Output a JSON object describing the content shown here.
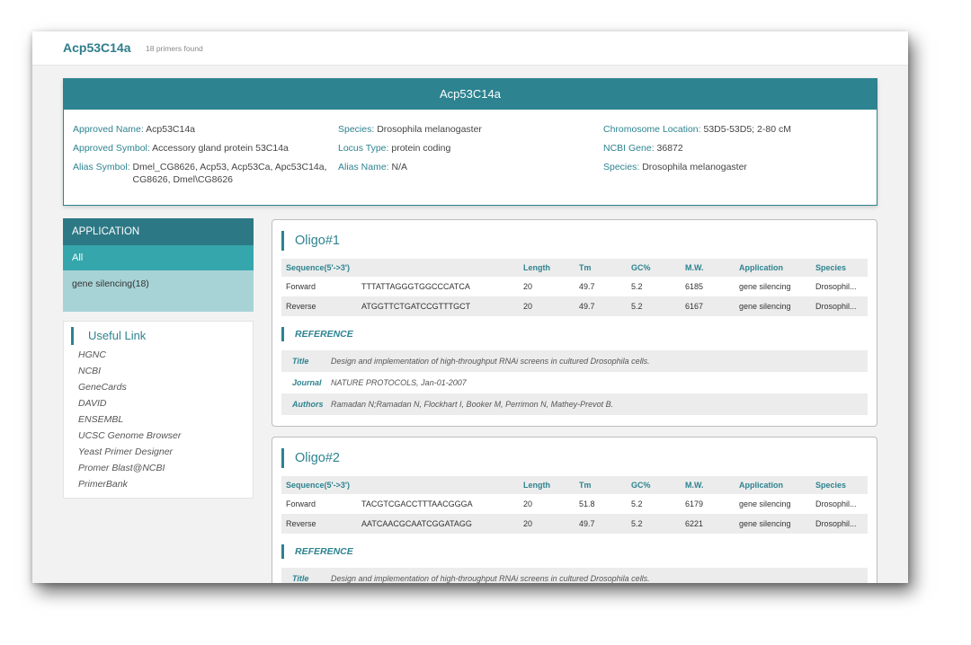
{
  "header": {
    "gene": "Acp53C14a",
    "count": "18 primers found"
  },
  "info": {
    "title": "Acp53C14a",
    "col1": [
      {
        "key": "Approved Name:",
        "value": "Acp53C14a"
      },
      {
        "key": "Approved Symbol:",
        "value": "Accessory gland protein 53C14a"
      },
      {
        "key": "Alias Symbol:",
        "value": "Dmel_CG8626, Acp53, Acp53Ca, Apc53C14a, CG8626, Dmel\\CG8626"
      }
    ],
    "col2": [
      {
        "key": "Species:",
        "value": "Drosophila melanogaster"
      },
      {
        "key": "Locus Type:",
        "value": "protein coding"
      },
      {
        "key": "Alias Name:",
        "value": "N/A"
      }
    ],
    "col3": [
      {
        "key": "Chromosome Location:",
        "value": "53D5-53D5; 2-80 cM"
      },
      {
        "key": "NCBI Gene:",
        "value": "36872"
      },
      {
        "key": "Species:",
        "value": "Drosophila melanogaster"
      }
    ]
  },
  "application": {
    "title": "APPLICATION",
    "all": "All",
    "option": "gene silencing(18)"
  },
  "links": {
    "title": "Useful Link",
    "items": [
      "HGNC",
      "NCBI",
      "GeneCards",
      "DAVID",
      "ENSEMBL",
      "UCSC Genome Browser",
      "Yeast Primer Designer",
      "Promer Blast@NCBI",
      "PrimerBank"
    ]
  },
  "table_headers": [
    "Sequence(5'->3')",
    "",
    "Length",
    "Tm",
    "GC%",
    "M.W.",
    "Application",
    "Species"
  ],
  "reference_label": "REFERENCE",
  "oligos": [
    {
      "title": "Oligo#1",
      "rows": [
        [
          "Forward",
          "TTTATTAGGGTGGCCCATCA",
          "20",
          "49.7",
          "5.2",
          "6185",
          "gene silencing",
          "Drosophil..."
        ],
        [
          "Reverse",
          "ATGGTTCTGATCCGTTTGCT",
          "20",
          "49.7",
          "5.2",
          "6167",
          "gene silencing",
          "Drosophil..."
        ]
      ],
      "reference": {
        "title_label": "Title",
        "title": "Design and implementation of high-throughput RNAi screens in cultured Drosophila cells.",
        "journal_label": "Journal",
        "journal": "NATURE PROTOCOLS, Jan-01-2007",
        "authors_label": "Authors",
        "authors": "Ramadan N;Ramadan N, Flockhart I, Booker M, Perrimon N, Mathey-Prevot B."
      }
    },
    {
      "title": "Oligo#2",
      "rows": [
        [
          "Forward",
          "TACGTCGACCTTTAACGGGA",
          "20",
          "51.8",
          "5.2",
          "6179",
          "gene silencing",
          "Drosophil..."
        ],
        [
          "Reverse",
          "AATCAACGCAATCGGATAGG",
          "20",
          "49.7",
          "5.2",
          "6221",
          "gene silencing",
          "Drosophil..."
        ]
      ],
      "reference": {
        "title_label": "Title",
        "title": "Design and implementation of high-throughput RNAi screens in cultured Drosophila cells."
      }
    }
  ],
  "colors": {
    "accent": "#2d8390",
    "accent_light": "#35a7ac",
    "panel_light": "#a8d3d6"
  }
}
